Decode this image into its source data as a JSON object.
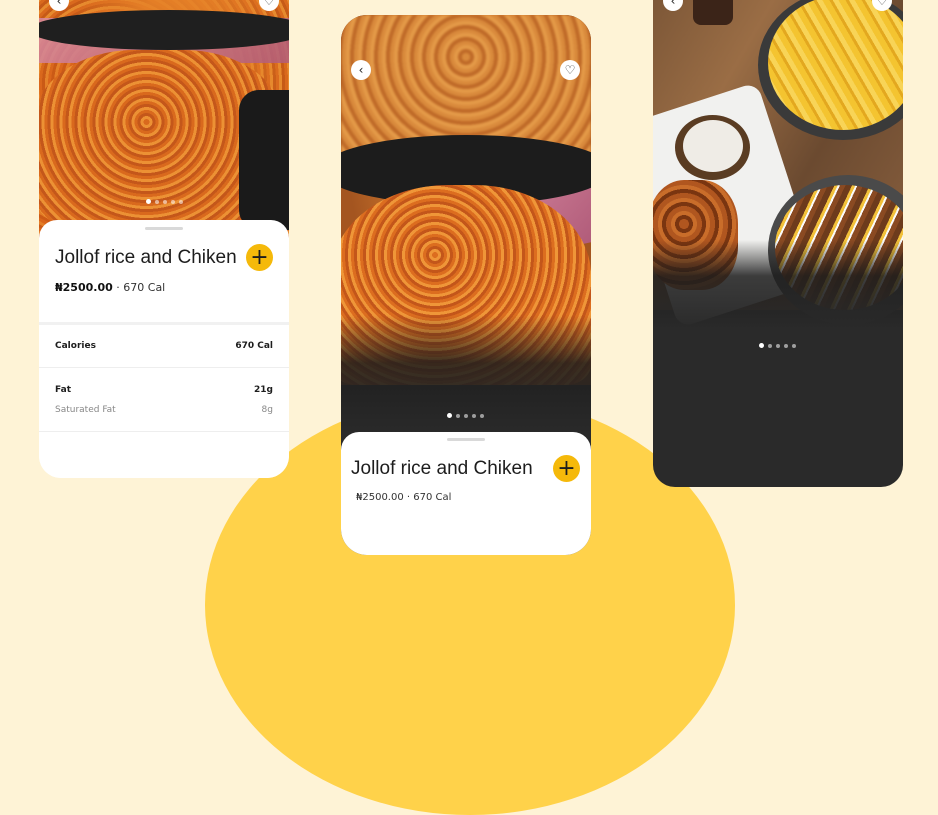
{
  "product": {
    "name": "Jollof rice and Chiken",
    "price": "₦2500.00",
    "separator": "·",
    "calories": "670 Cal"
  },
  "nutrition": {
    "calories_label": "Calories",
    "calories_value": "670 Cal",
    "fat_label": "Fat",
    "fat_value": "21g",
    "sat_fat_label": "Saturated Fat",
    "sat_fat_value": "8g"
  },
  "actions": {
    "add_symbol": "+",
    "back_symbol": "‹",
    "favorite_symbol": "♡"
  },
  "carousel": {
    "slide_count": 5,
    "active_index": 0
  },
  "colors": {
    "background": "#FEF3D6",
    "accent_blob": "#FFD24A",
    "add_button": "#F5B90A",
    "dark_panel": "#2a2a2a"
  }
}
